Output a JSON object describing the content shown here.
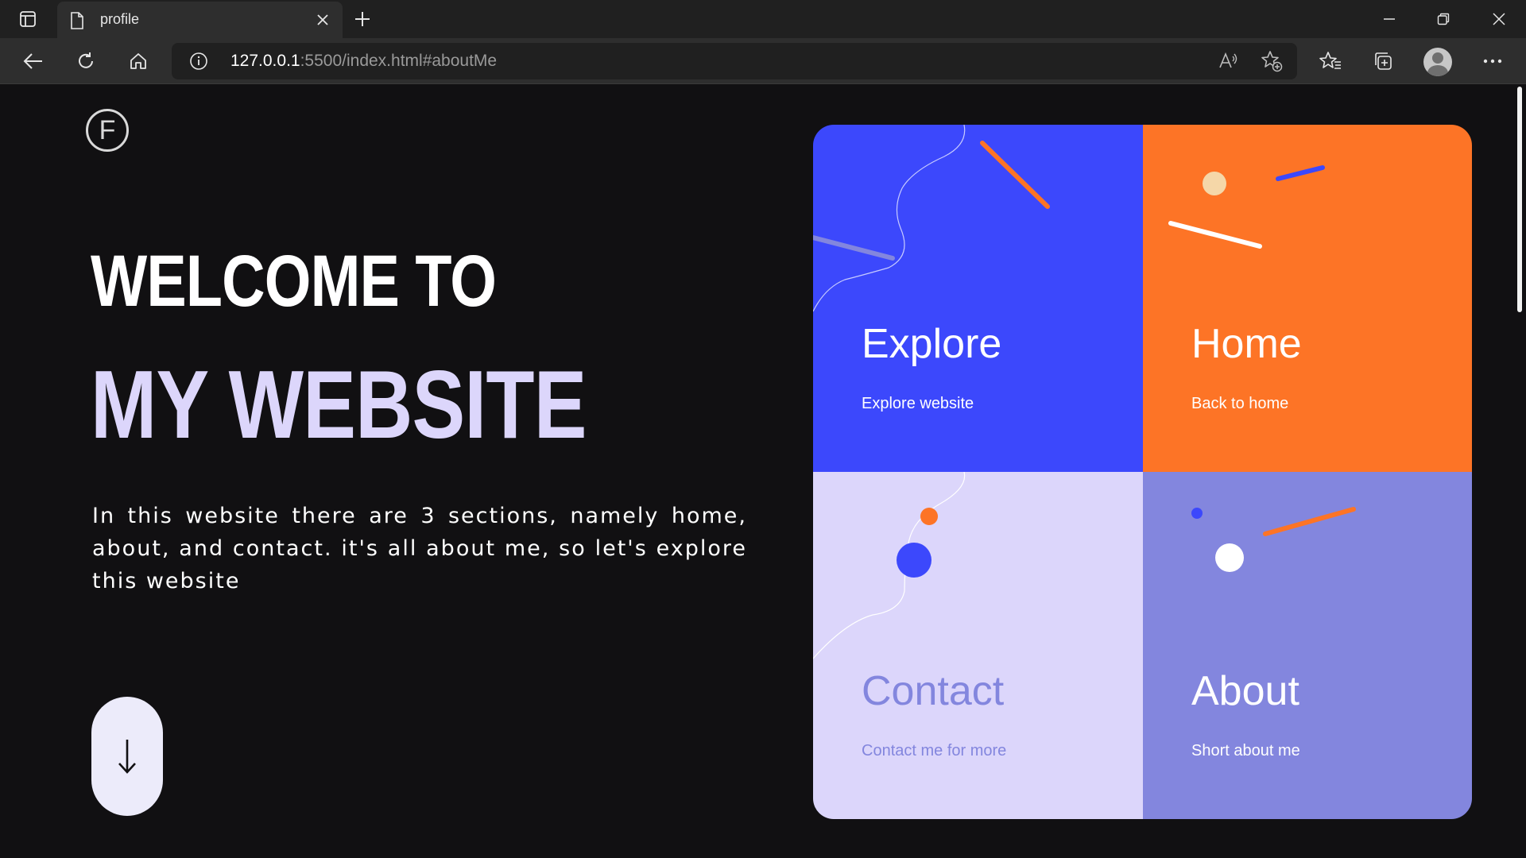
{
  "browser": {
    "tab_title": "profile",
    "url_host": "127.0.0.1",
    "url_rest": ":5500/index.html#aboutMe"
  },
  "page": {
    "logo_letter": "F",
    "headline_1": "WELCOME TO",
    "headline_2": "MY WEBSITE",
    "description": "In this website there are 3 sections, namely home, about, and contact. it's all about me, so let's explore this website",
    "scroll_arrow": "↓"
  },
  "cards": [
    {
      "title": "Explore",
      "subtitle": "Explore website",
      "color": "#3c48fc"
    },
    {
      "title": "Home",
      "subtitle": "Back to home",
      "color": "#fd7426"
    },
    {
      "title": "Contact",
      "subtitle": "Contact me for more",
      "color": "#dcd6fb"
    },
    {
      "title": "About",
      "subtitle": "Short about me",
      "color": "#8386de"
    }
  ],
  "colors": {
    "background": "#111012",
    "accent_lavender": "#dcd6fb",
    "accent_blue": "#3c48fc",
    "accent_orange": "#fd7426",
    "accent_purple": "#8386de"
  },
  "icons": [
    "tab-actions-icon",
    "document-icon",
    "close-icon",
    "plus-icon",
    "minimize-icon",
    "restore-icon",
    "back-arrow-icon",
    "reload-icon",
    "home-icon",
    "info-icon",
    "read-aloud-icon",
    "add-favorite-icon",
    "favorites-icon",
    "collections-icon",
    "profile-icon",
    "more-icon",
    "arrow-down-icon"
  ]
}
